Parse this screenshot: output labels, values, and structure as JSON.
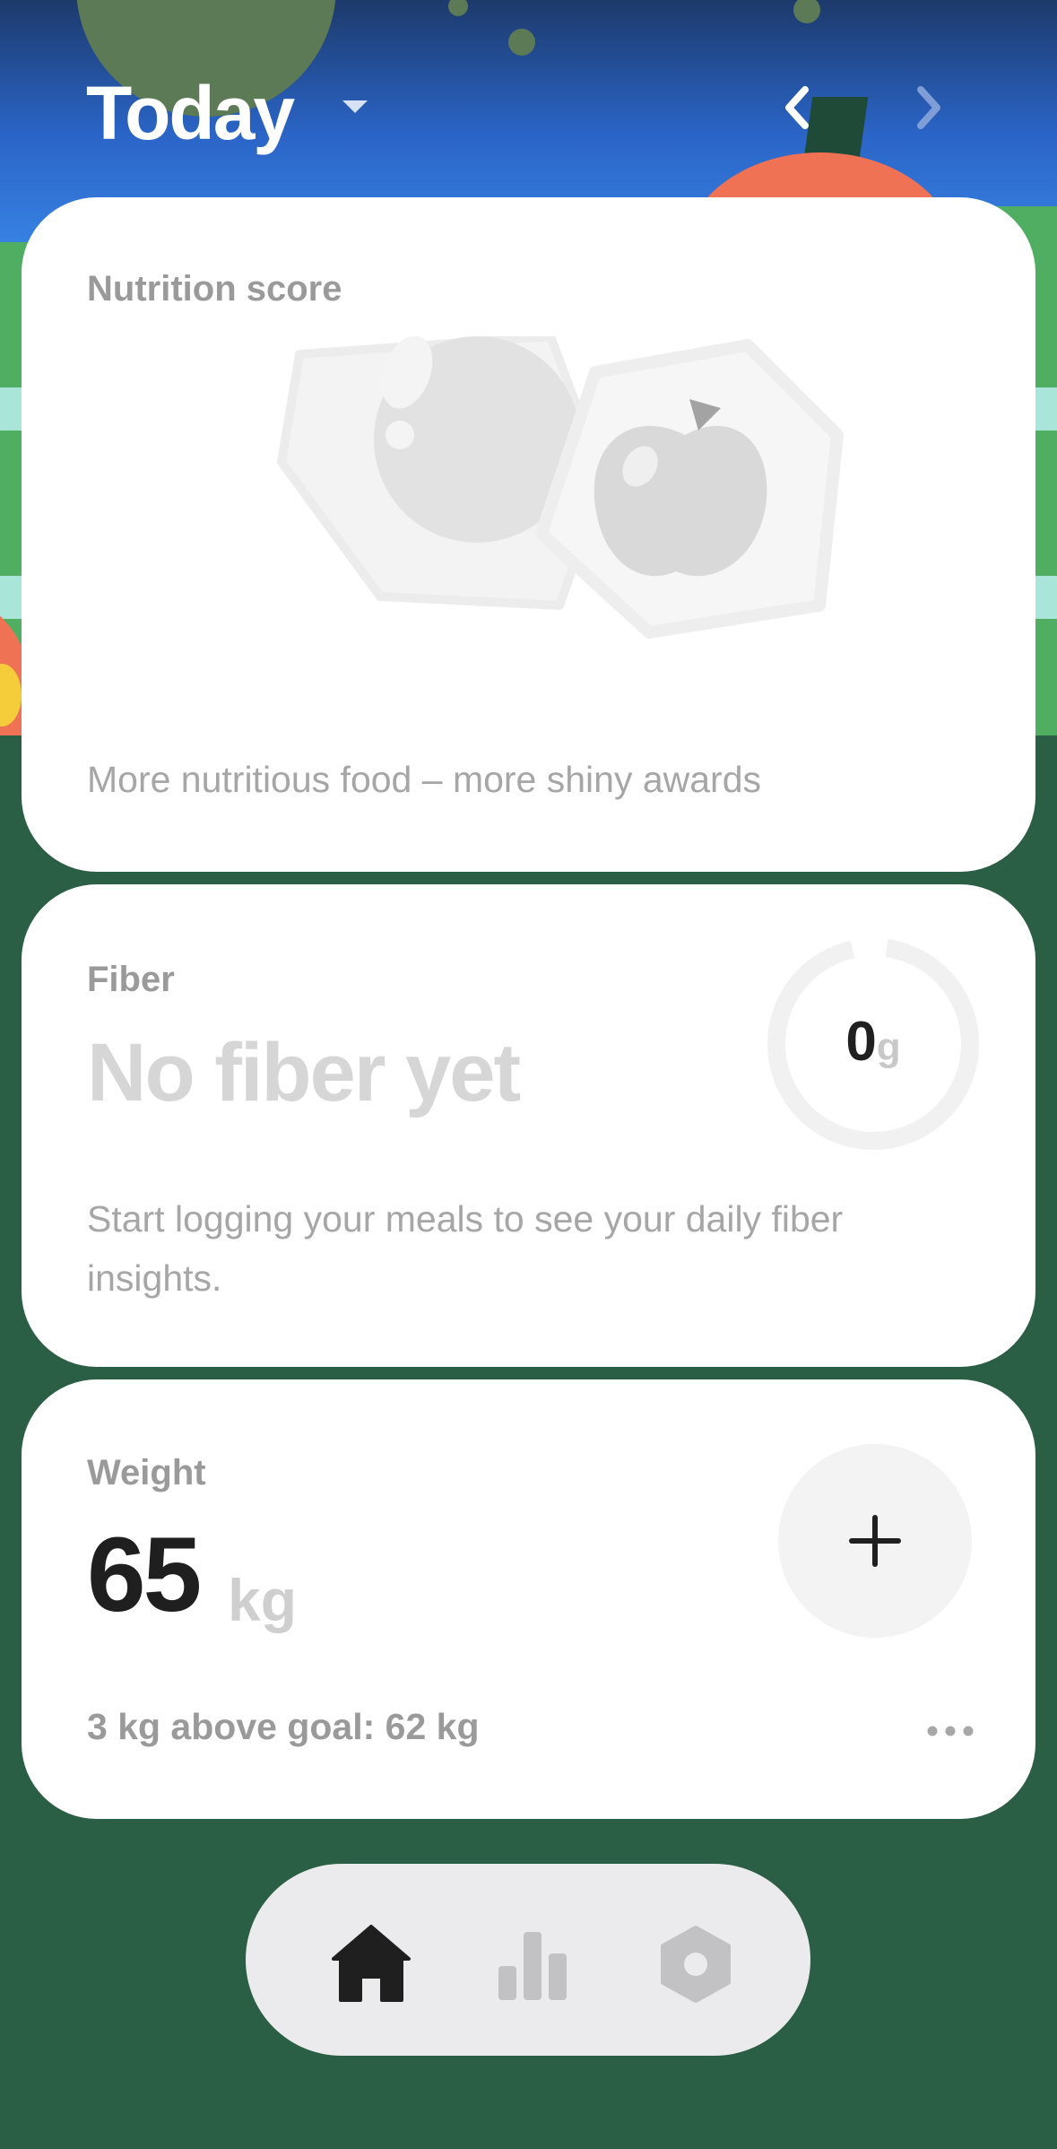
{
  "header": {
    "title": "Today",
    "icons": {
      "dropdown": "chevron-down-icon",
      "prev": "chevron-left-icon",
      "next": "chevron-right-icon"
    }
  },
  "nutrition": {
    "label": "Nutrition score",
    "note": "More nutritious food – more shiny awards",
    "icon": "awards-badges-icon"
  },
  "fiber": {
    "label": "Fiber",
    "status": "No fiber yet",
    "value": "0",
    "unit": "g",
    "note": "Start logging your meals to see your daily fiber insights.",
    "progress_fraction": 0
  },
  "weight": {
    "label": "Weight",
    "value": "65",
    "unit": "kg",
    "goal_text": "3 kg above goal: 62 kg",
    "add_icon": "plus-icon",
    "more_icon": "more-horizontal-icon"
  },
  "tabbar": {
    "tabs": [
      {
        "name": "home",
        "icon": "home-icon",
        "active": true
      },
      {
        "name": "stats",
        "icon": "bar-chart-icon",
        "active": false
      },
      {
        "name": "settings",
        "icon": "settings-hexagon-icon",
        "active": false
      }
    ]
  },
  "colors": {
    "background": "#2a5e45",
    "card": "#ffffff",
    "primary_text": "#1f1f1f",
    "muted_text": "#9a9a9a",
    "tabbar": "#ebebee"
  }
}
